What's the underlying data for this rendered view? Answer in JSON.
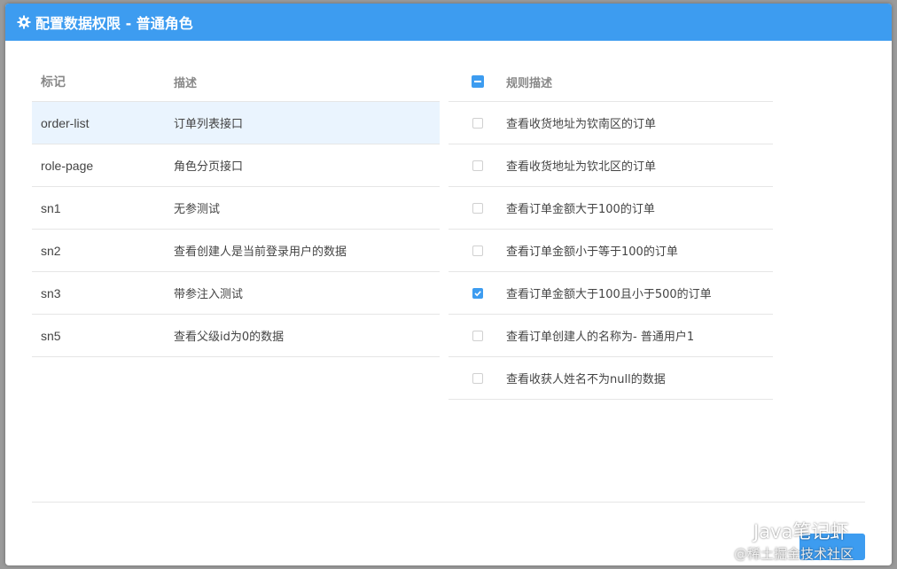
{
  "dialog": {
    "title": "配置数据权限 - 普通角色"
  },
  "left_table": {
    "headers": {
      "mark": "标记",
      "desc": "描述"
    },
    "rows": [
      {
        "mark": "order-list",
        "desc": "订单列表接口",
        "selected": true
      },
      {
        "mark": "role-page",
        "desc": "角色分页接口",
        "selected": false
      },
      {
        "mark": "sn1",
        "desc": "无参测试",
        "selected": false
      },
      {
        "mark": "sn2",
        "desc": "查看创建人是当前登录用户的数据",
        "selected": false
      },
      {
        "mark": "sn3",
        "desc": "带参注入测试",
        "selected": false
      },
      {
        "mark": "sn5",
        "desc": "查看父级id为0的数据",
        "selected": false
      }
    ]
  },
  "right_table": {
    "headers": {
      "rule": "规则描述"
    },
    "header_checkbox_state": "indeterminate",
    "rows": [
      {
        "rule": "查看收货地址为钦南区的订单",
        "checked": false
      },
      {
        "rule": "查看收货地址为钦北区的订单",
        "checked": false
      },
      {
        "rule": "查看订单金额大于100的订单",
        "checked": false
      },
      {
        "rule": "查看订单金额小于等于100的订单",
        "checked": false
      },
      {
        "rule": "查看订单金额大于100且小于500的订单",
        "checked": true
      },
      {
        "rule": "查看订单创建人的名称为- 普通用户1",
        "checked": false
      },
      {
        "rule": "查看收获人姓名不为null的数据",
        "checked": false
      }
    ]
  },
  "watermark": {
    "line1": "Java笔记虾",
    "line2": "@稀土掘金技术社区"
  },
  "colors": {
    "accent": "#3d9cf0",
    "selected_row": "#eaf4fe",
    "border": "#e6e6e6"
  },
  "icons": {
    "title_icon": "gear-icon",
    "watermark_icon": "wechat-icon"
  }
}
